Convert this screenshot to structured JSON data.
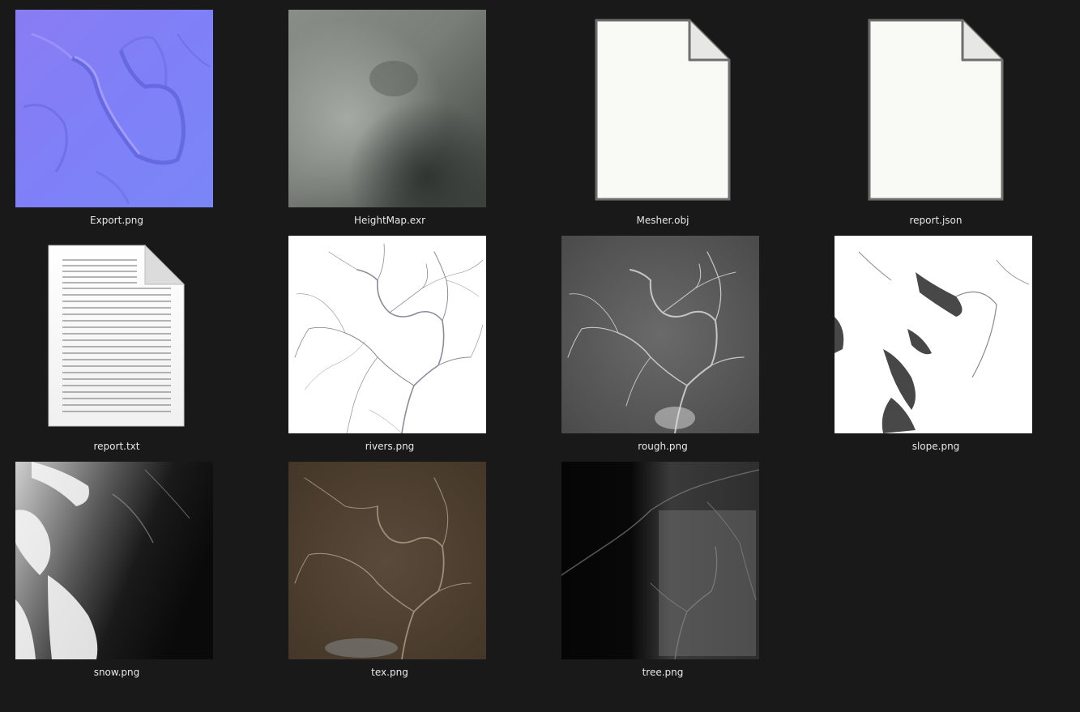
{
  "files": [
    {
      "name": "Export.png"
    },
    {
      "name": "HeightMap.exr"
    },
    {
      "name": "Mesher.obj"
    },
    {
      "name": "report.json"
    },
    {
      "name": "report.txt"
    },
    {
      "name": "rivers.png"
    },
    {
      "name": "rough.png"
    },
    {
      "name": "slope.png"
    },
    {
      "name": "snow.png"
    },
    {
      "name": "tex.png"
    },
    {
      "name": "tree.png"
    }
  ],
  "colors": {
    "background": "#19191a",
    "label_text": "#e8e8e8"
  },
  "icons": {
    "generic_file": "blank-document-icon",
    "text_file": "lined-text-document-icon"
  }
}
